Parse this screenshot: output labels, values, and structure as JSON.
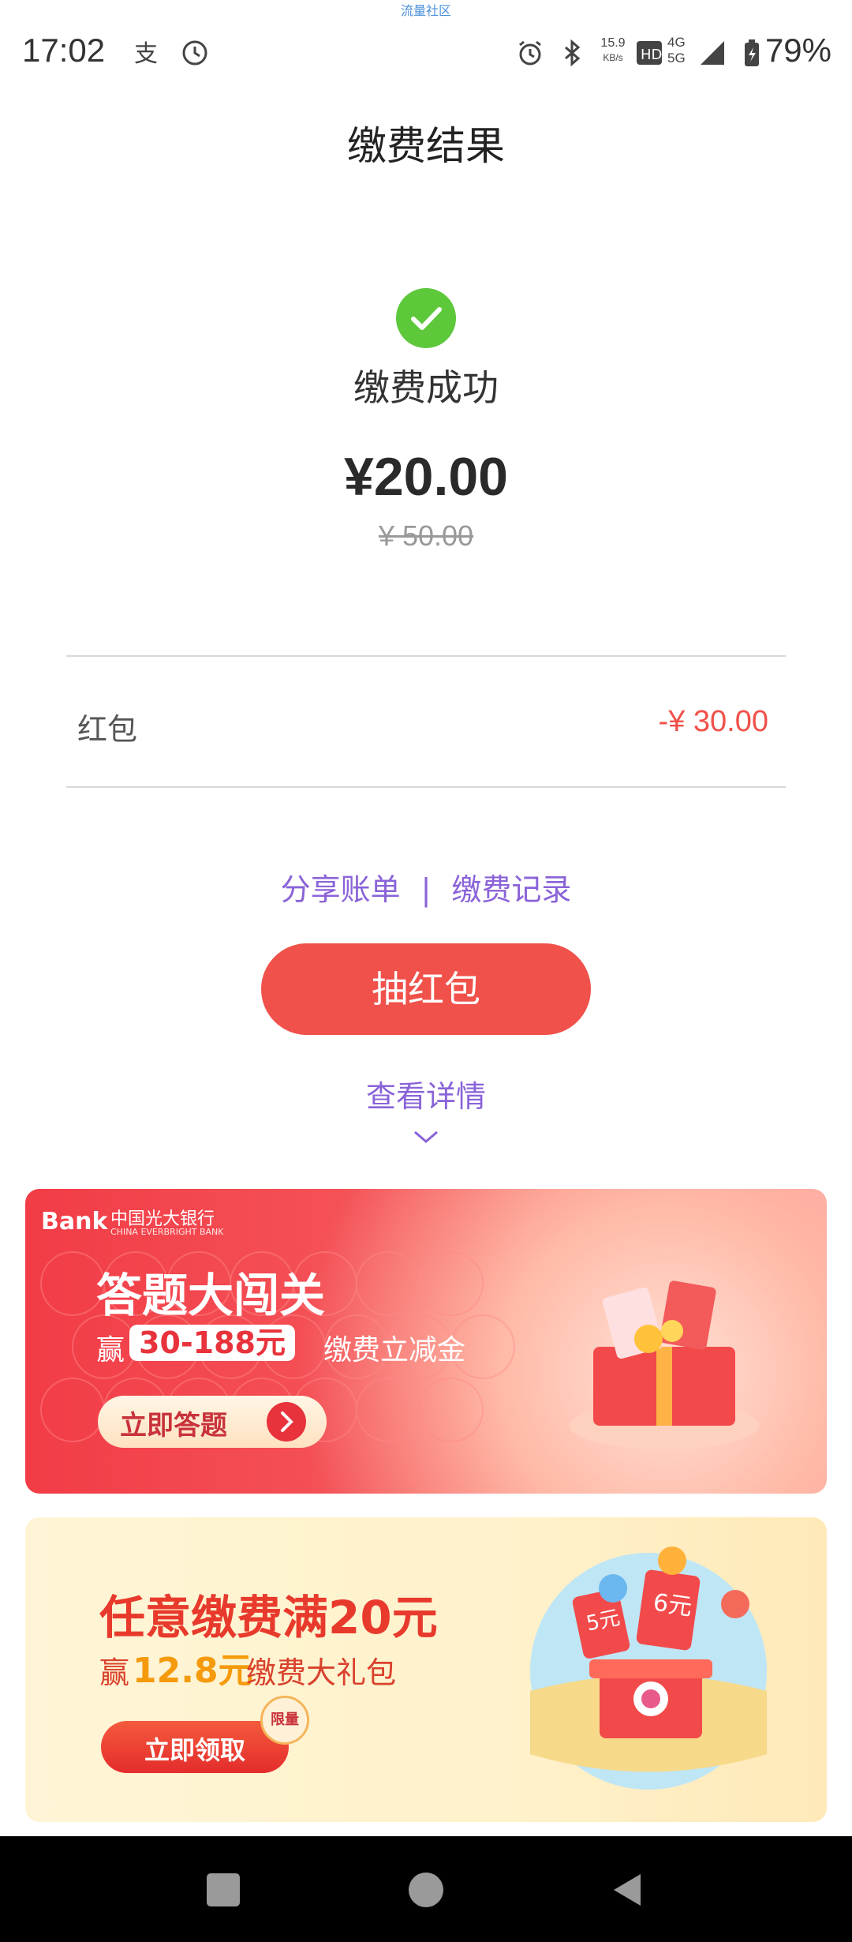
{
  "status_bar": {
    "watermark": "流量社区",
    "time": "17:02",
    "net_speed_value": "15.9",
    "net_speed_unit": "KB/s",
    "sim_label": "4G",
    "sim_label2": "5G",
    "battery": "79%"
  },
  "header": {
    "title": "缴费结果"
  },
  "result": {
    "status": "缴费成功",
    "amount": "¥20.00",
    "original_amount": "¥ 50.00"
  },
  "discount": {
    "label": "红包",
    "value": "-¥ 30.00"
  },
  "actions": {
    "share_bill": "分享账单",
    "separator": "|",
    "payment_records": "缴费记录",
    "draw_red_packet": "抽红包",
    "view_details": "查看详情"
  },
  "banner_quiz": {
    "bank_logo": "Bank",
    "bank_name": "中国光大银行",
    "bank_name_en": "CHINA EVERBRIGHT BANK",
    "title": "答题大闯关",
    "win_prefix": "赢",
    "amount": "30-188元",
    "suffix": "缴费立减金",
    "button": "立即答题"
  },
  "banner_gift": {
    "title": "任意缴费满20元",
    "win_prefix": "赢",
    "amount": "12.8元",
    "suffix": "缴费大礼包",
    "button": "立即领取",
    "badge": "限量"
  },
  "colors": {
    "accent_purple": "#8a63d8",
    "primary_red": "#f0514a",
    "success_green": "#5cc83a"
  }
}
